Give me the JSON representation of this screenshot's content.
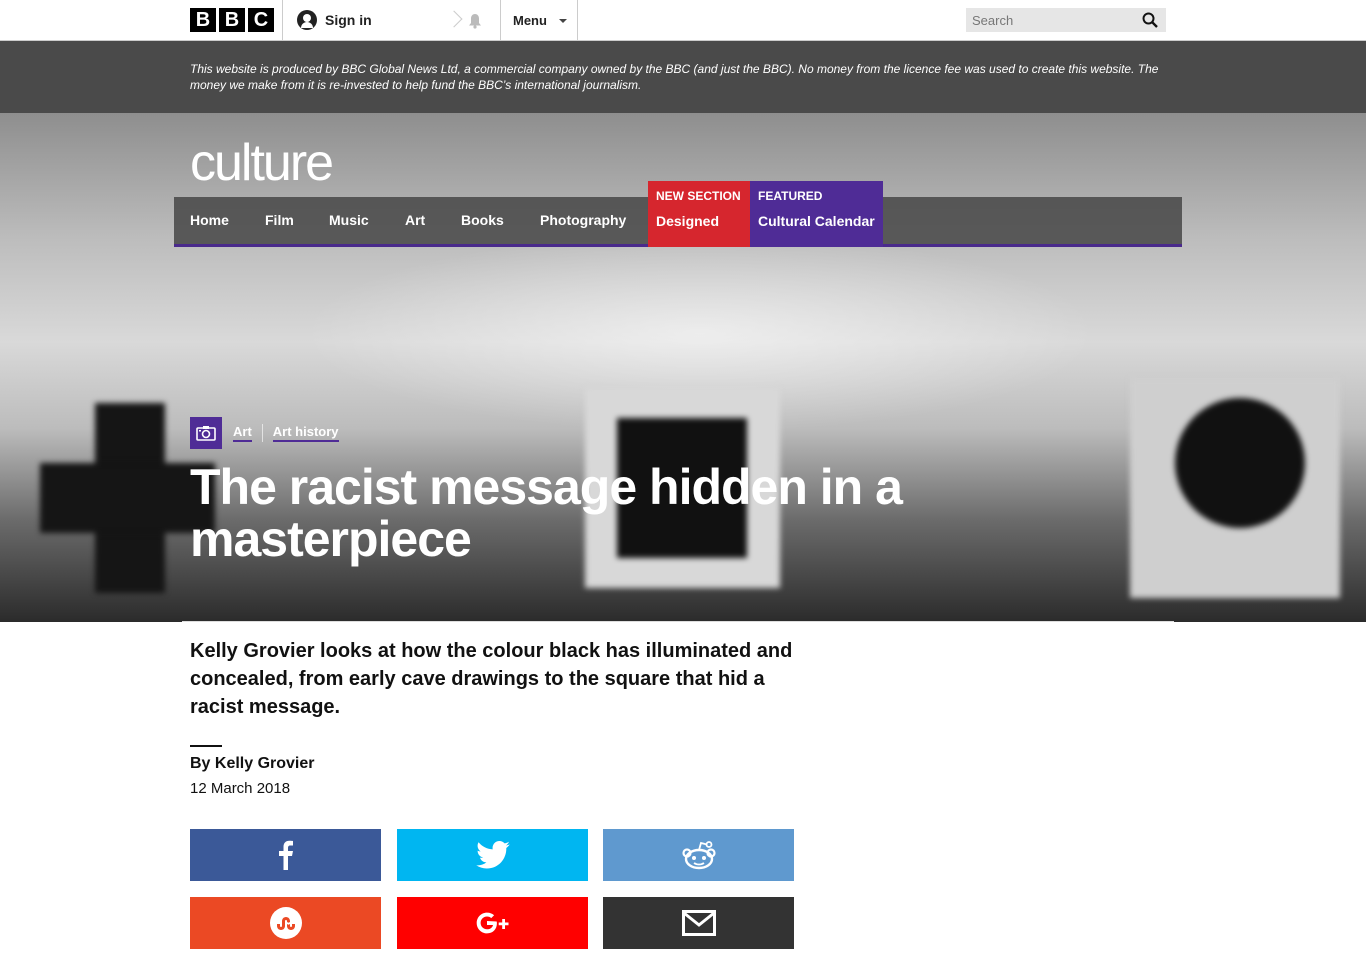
{
  "topbar": {
    "logo_letters": [
      "B",
      "B",
      "C"
    ],
    "signin_label": "Sign in",
    "menu_label": "Menu",
    "search_placeholder": "Search"
  },
  "notice": {
    "text": "This website is produced by BBC Global News Ltd, a commercial company owned by the BBC (and just the BBC). No money from the licence fee was used to create this website. The money we make from it is re-invested to help fund the BBC’s international journalism."
  },
  "hero": {
    "section_logo": "culture",
    "nav": {
      "items": [
        "Home",
        "Film",
        "Music",
        "Art",
        "Books",
        "Photography"
      ],
      "new_section": {
        "kicker": "New Section",
        "label": "Designed",
        "color": "#d6262e"
      },
      "featured": {
        "kicker": "Featured",
        "label": "Cultural Calendar",
        "color": "#4f2c96"
      }
    },
    "breadcrumbs": [
      "Art",
      "Art history"
    ],
    "headline": "The racist message hidden in a masterpiece"
  },
  "article": {
    "standfirst": "Kelly Grovier looks at how the colour black has illuminated and concealed, from early cave drawings to the square that hid a racist message.",
    "byline": "By Kelly Grovier",
    "date": "12 March 2018"
  },
  "share": {
    "buttons": [
      {
        "icon": "facebook-icon",
        "color": "#3b5998"
      },
      {
        "icon": "twitter-icon",
        "color": "#00b6f1"
      },
      {
        "icon": "reddit-icon",
        "color": "#5f99cf"
      },
      {
        "icon": "stumbleupon-icon",
        "color": "#eb4924"
      },
      {
        "icon": "google-plus-icon",
        "color": "#ff0000"
      },
      {
        "icon": "email-icon",
        "color": "#333333"
      }
    ]
  }
}
